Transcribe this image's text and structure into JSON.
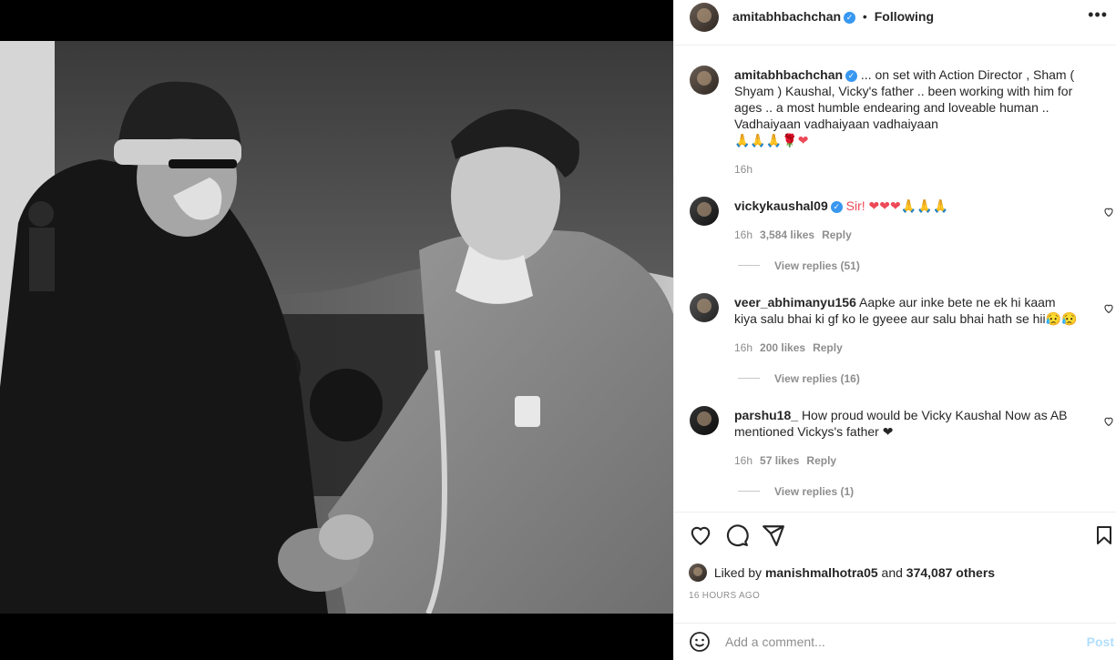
{
  "post": {
    "author": "amitabhbachchan",
    "follow_status": "Following",
    "dot": "•",
    "more": "•••",
    "caption": "... on set with Action Director , Sham ( Shyam ) Kaushal, Vicky's father .. been working with him for ages .. a most humble endearing and loveable human ..",
    "caption_line2": "Vadhaiyaan vadhaiyaan vadhaiyaan",
    "caption_emoji": "🙏🙏🙏🌹❤",
    "caption_time": "16h"
  },
  "comments": [
    {
      "user": "vickykaushal09",
      "verified": true,
      "text": "Sir! ❤❤❤🙏🙏🙏",
      "time": "16h",
      "likes": "3,584 likes",
      "reply": "Reply",
      "view_replies": "View replies (51)"
    },
    {
      "user": "veer_abhimanyu156",
      "verified": false,
      "text": "Aapke aur inke bete ne ek hi kaam kiya salu bhai ki gf ko le gyeee aur salu bhai hath se hii😥😥",
      "time": "16h",
      "likes": "200 likes",
      "reply": "Reply",
      "view_replies": "View replies (16)"
    },
    {
      "user": "parshu18_",
      "verified": false,
      "text": "How proud would be Vicky Kaushal Now as AB mentioned Vickys's father ❤",
      "time": "16h",
      "likes": "57 likes",
      "reply": "Reply",
      "view_replies": "View replies (1)"
    }
  ],
  "likes": {
    "prefix": "Liked by",
    "user": "manishmalhotra05",
    "middle": "and",
    "others": "374,087 others"
  },
  "timestamp": "16 HOURS AGO",
  "add_comment": {
    "placeholder": "Add a comment...",
    "post_label": "Post"
  },
  "icons": {
    "like": "heart-icon",
    "comment": "comment-icon",
    "share": "share-icon",
    "save": "bookmark-icon",
    "emoji": "emoji-icon"
  },
  "colors": {
    "verified": "#3897f0",
    "post_disabled": "#b2dffc",
    "muted": "#8e8e8e",
    "heart": "#ed4956"
  }
}
